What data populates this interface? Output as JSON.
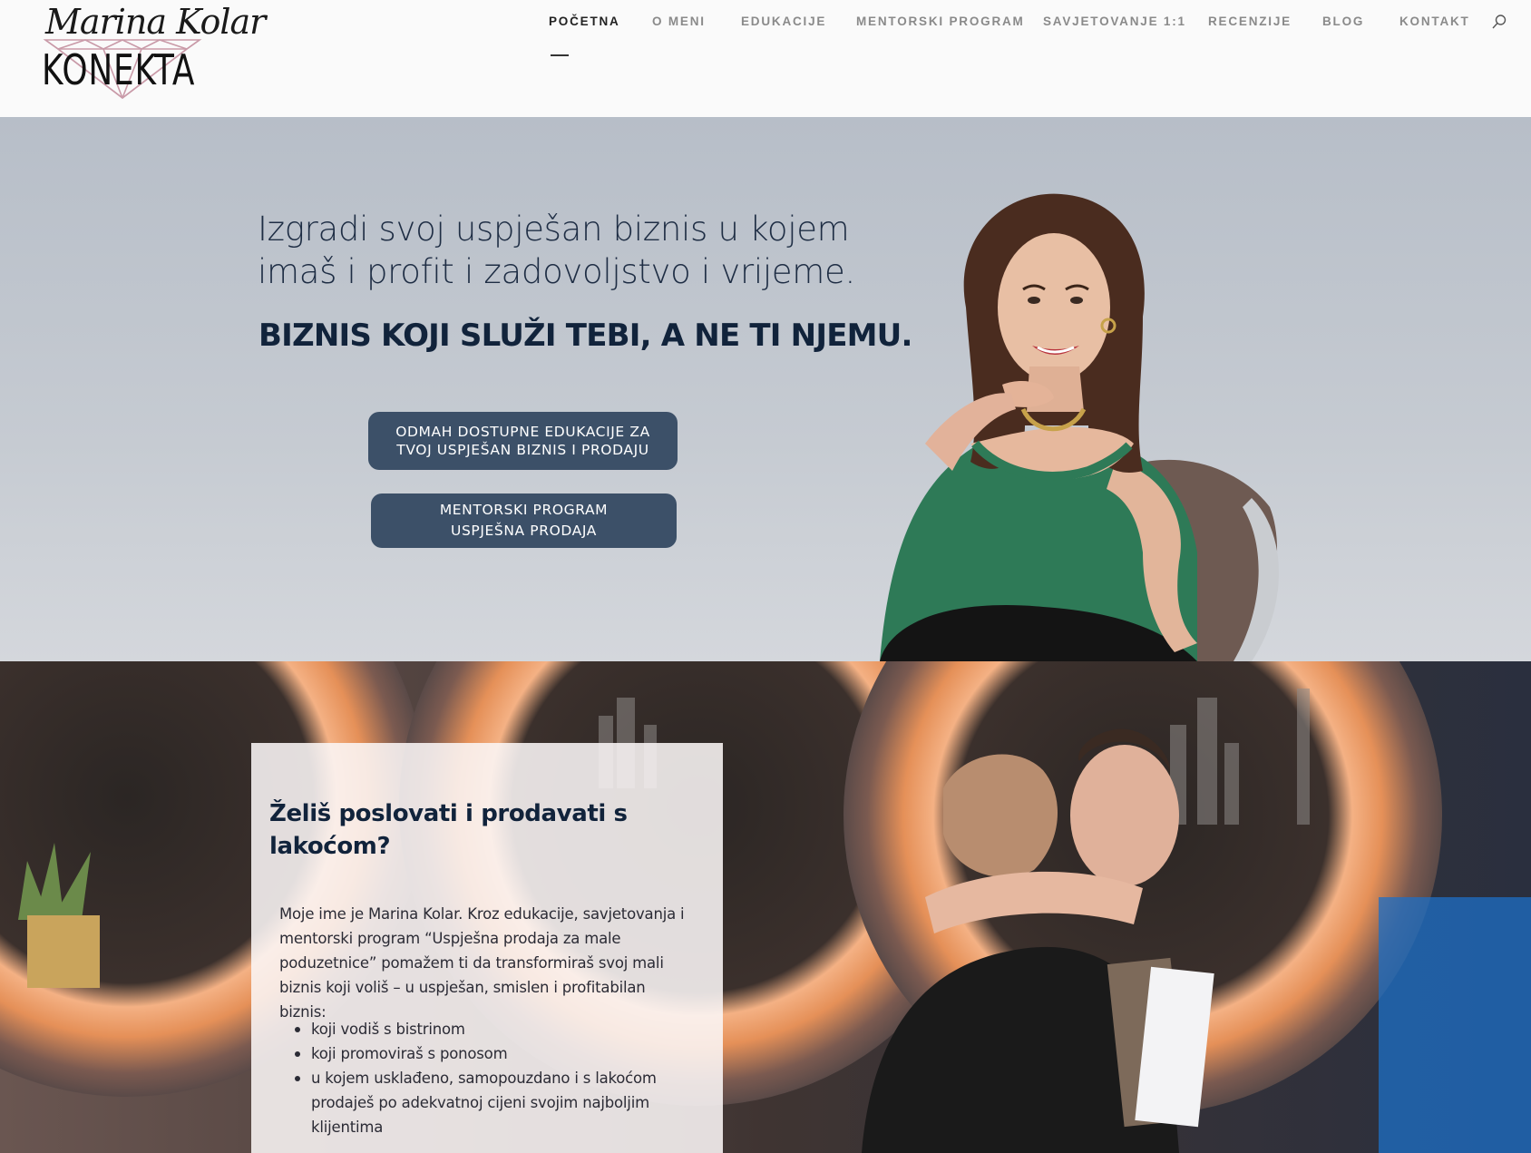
{
  "header": {
    "logo_script": "Marina Kolar",
    "logo_word": "KONEKTA",
    "nav": [
      {
        "label": "POČETNA",
        "active": true
      },
      {
        "label": "O MENI"
      },
      {
        "label": "EDUKACIJE"
      },
      {
        "label": "MENTORSKI PROGRAM"
      },
      {
        "label": "SAVJETOVANJE 1:1"
      },
      {
        "label": "RECENZIJE"
      },
      {
        "label": "BLOG"
      },
      {
        "label": "KONTAKT"
      }
    ],
    "search_icon": "search-icon"
  },
  "hero": {
    "subtitle": "Izgradi svoj uspješan biznis u kojem imaš i profit i zadovoljstvo i vrijeme.",
    "title": "BIZNIS KOJI SLUŽI TEBI, A NE TI NJEMU.",
    "button_1": {
      "line1": "ODMAH DOSTUPNE EDUKACIJE ZA",
      "line2": "TVOJ USPJEŠAN BIZNIS I PRODAJU"
    },
    "button_2": {
      "line1": "MENTORSKI PROGRAM",
      "line2": "USPJEŠNA PRODAJA"
    }
  },
  "intro": {
    "title": "Želiš poslovati i prodavati s lakoćom?",
    "text": "Moje ime je Marina Kolar. Kroz edukacije, savjetovanja i mentorski program “Uspješna prodaja za male poduzetnice” pomažem ti da transformiraš svoj mali biznis koji voliš – u uspješan, smislen i profitabilan biznis:",
    "bullets": [
      "koji vodiš s bistrinom",
      "koji promoviraš s ponosom",
      "u kojem usklađeno, samopouzdano i s lakoćom prodaješ po adekvatnoj cijeni svojim najboljim klijentima"
    ]
  },
  "colors": {
    "nav_active": "#222222",
    "nav_inactive": "#8a8a8a",
    "title_navy": "#11233b",
    "button_bg": "#3c5068",
    "hero_bg": "#bfc5ce"
  }
}
